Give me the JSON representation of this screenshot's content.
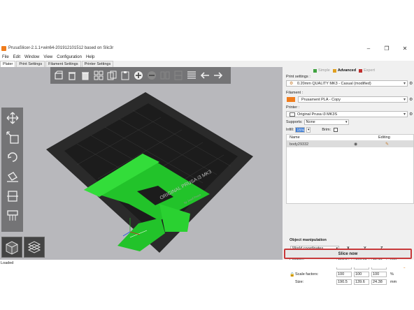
{
  "window": {
    "title": "PrusaSlicer-2.1.1+win64-201912101512 based on Slic3r",
    "controls": [
      "minimize-icon",
      "maximize-icon",
      "close-icon"
    ]
  },
  "menu": [
    "File",
    "Edit",
    "Window",
    "View",
    "Configuration",
    "Help"
  ],
  "tabs": [
    {
      "label": "Plater",
      "active": true
    },
    {
      "label": "Print Settings"
    },
    {
      "label": "Filament Settings"
    },
    {
      "label": "Printer Settings"
    }
  ],
  "modes": [
    {
      "label": "Simple",
      "color": "#3fa23f"
    },
    {
      "label": "Advanced",
      "color": "#e0a020",
      "active": true
    },
    {
      "label": "Expert",
      "color": "#c0302e"
    }
  ],
  "print_settings": {
    "label": "Print settings :",
    "value": "0.20mm QUALITY MK3 - Casual (modified)"
  },
  "filament": {
    "label": "Filament :",
    "value": "Prusament PLA - Copy",
    "color": "#f07c1c"
  },
  "printer": {
    "label": "Printer :",
    "value": "Original Prusa i3 MK3S"
  },
  "supports": {
    "label": "Supports:",
    "value": "None"
  },
  "infill": {
    "label": "Infill:",
    "value": "15%"
  },
  "brim": {
    "label": "Brim:"
  },
  "object_list": {
    "name_header": "Name",
    "editing_header": "Editing",
    "items": [
      {
        "name": "body29332"
      }
    ]
  },
  "bed_text": {
    "brand": "ORIGINAL PRUSA i3 MK3",
    "by": "by Josef Prusa"
  },
  "object_manipulation": {
    "title": "Object manipulation",
    "coordinates": "World coordinates",
    "axes": [
      "X",
      "Y",
      "Z"
    ],
    "position": {
      "label": "Position:",
      "values": [
        "123.84",
        "100.03",
        "12.19"
      ],
      "unit": "mm"
    },
    "rotate": {
      "label": "Rotate:",
      "values": [
        "0",
        "0",
        "0"
      ],
      "unit": "°"
    },
    "scale": {
      "label": "Scale factors:",
      "values": [
        "100",
        "100",
        "100"
      ],
      "unit": "%"
    },
    "size": {
      "label": "Size:",
      "values": [
        "190.5",
        "139.6",
        "24.38"
      ],
      "unit": "mm"
    }
  },
  "slice_button": "Slice now",
  "status": "Loaded"
}
